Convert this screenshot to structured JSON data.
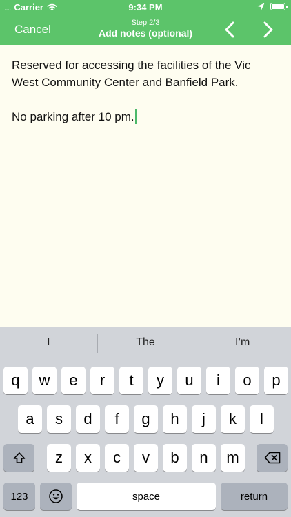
{
  "status_bar": {
    "signal": "....",
    "carrier": "Carrier",
    "time": "9:34 PM"
  },
  "nav": {
    "cancel_label": "Cancel",
    "step": "Step 2/3",
    "title": "Add notes (optional)"
  },
  "notes": {
    "paragraph1": "Reserved for accessing the facilities of the Vic West Community Center and Banfield Park.",
    "paragraph2": "No parking after 10 pm."
  },
  "keyboard": {
    "suggestions": [
      "I",
      "The",
      "I’m"
    ],
    "row1": [
      "q",
      "w",
      "e",
      "r",
      "t",
      "y",
      "u",
      "i",
      "o",
      "p"
    ],
    "row2": [
      "a",
      "s",
      "d",
      "f",
      "g",
      "h",
      "j",
      "k",
      "l"
    ],
    "row3": [
      "z",
      "x",
      "c",
      "v",
      "b",
      "n",
      "m"
    ],
    "numbers_label": "123",
    "space_label": "space",
    "return_label": "return"
  },
  "colors": {
    "accent": "#5cc46a",
    "notes_background": "#fefdf0",
    "caret": "#4cb96a",
    "keyboard_background": "#d1d4d9"
  }
}
